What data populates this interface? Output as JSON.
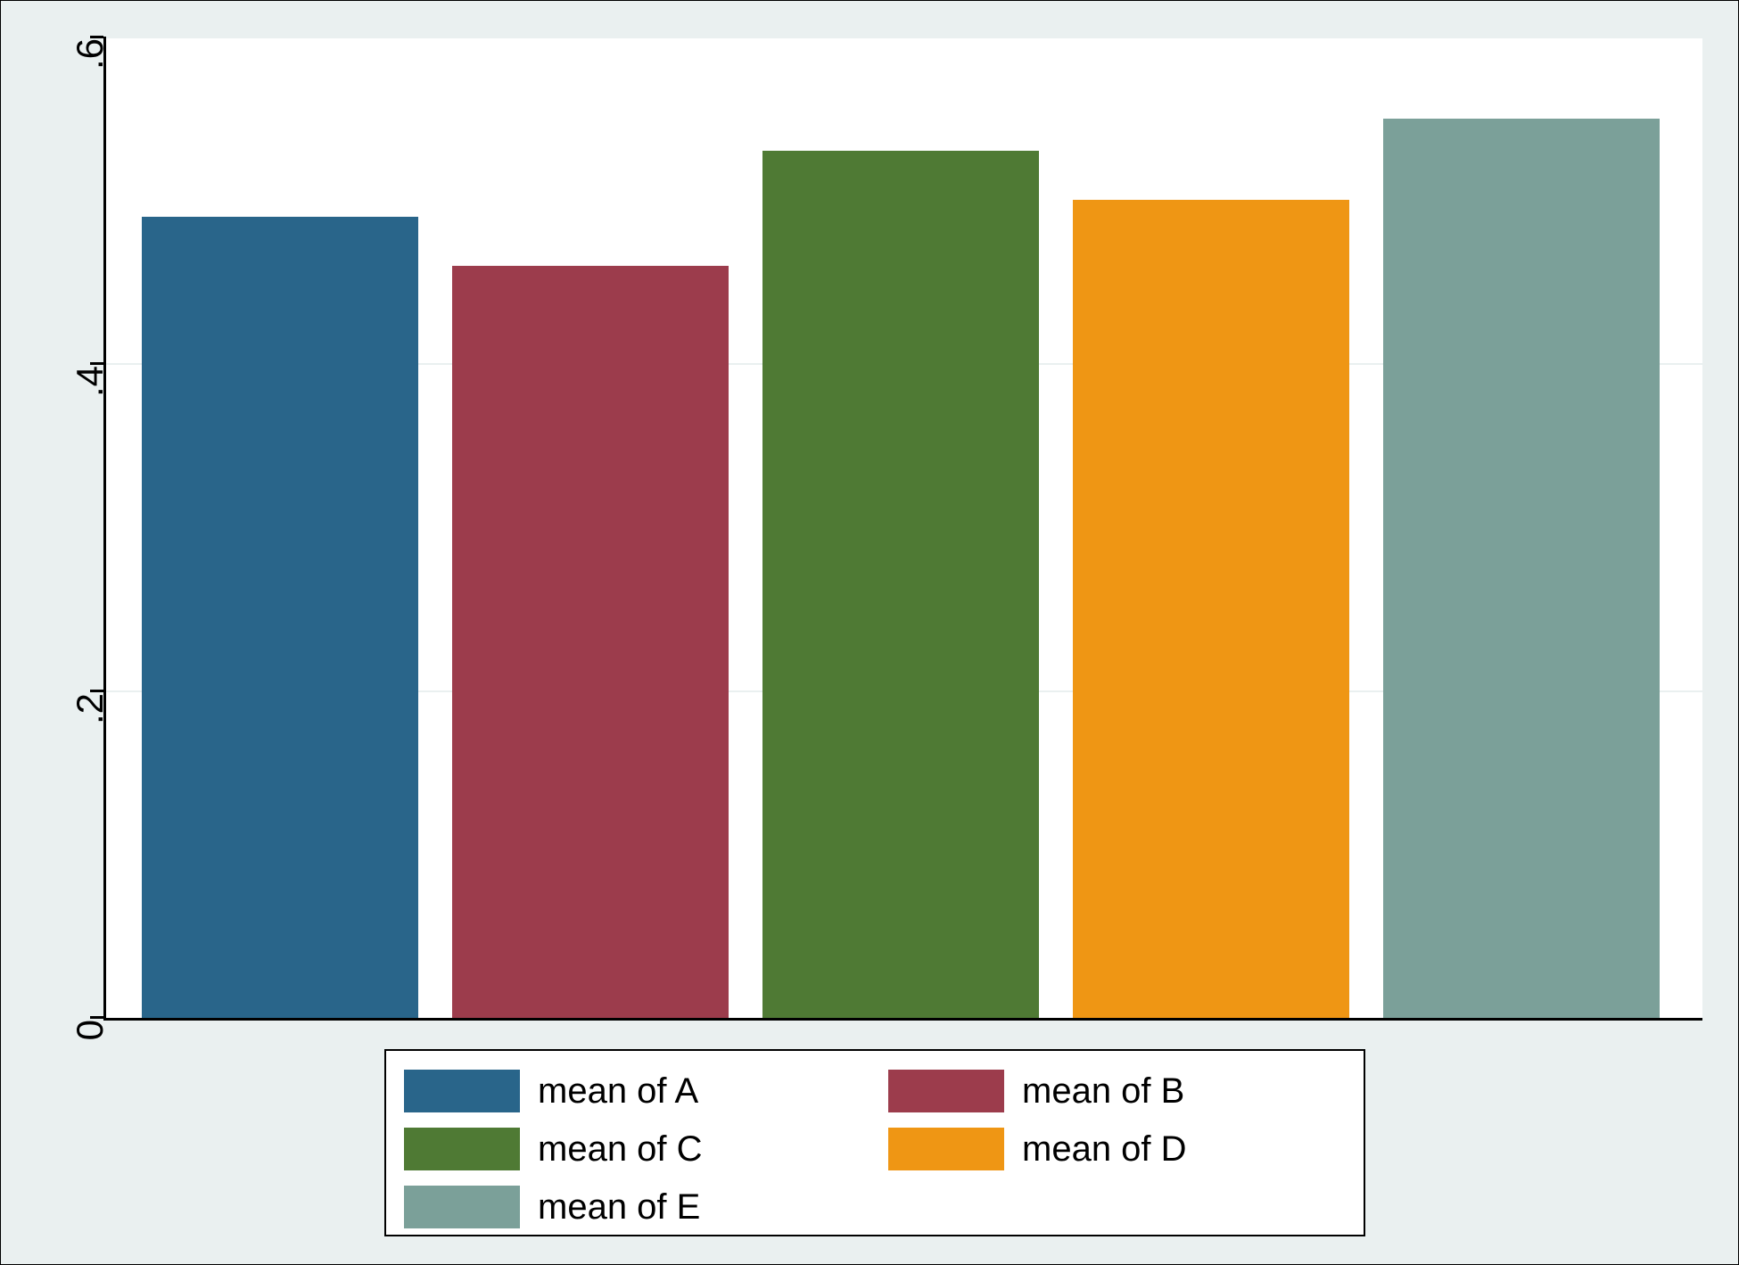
{
  "chart_data": {
    "type": "bar",
    "categories": [
      "A",
      "B",
      "C",
      "D",
      "E"
    ],
    "values": [
      0.49,
      0.46,
      0.53,
      0.5,
      0.55
    ],
    "series_labels": [
      "mean of A",
      "mean of B",
      "mean of C",
      "mean of D",
      "mean of E"
    ],
    "colors": [
      "#29658a",
      "#9c3c4c",
      "#4f7a34",
      "#ef9614",
      "#7ba099"
    ],
    "title": "",
    "xlabel": "",
    "ylabel": "",
    "ylim": [
      0,
      0.6
    ],
    "yticks": [
      0,
      0.2,
      0.4,
      0.6
    ],
    "ytick_labels": [
      "0",
      ".2",
      ".4",
      ".6"
    ],
    "grid": true,
    "legend_position": "bottom"
  }
}
